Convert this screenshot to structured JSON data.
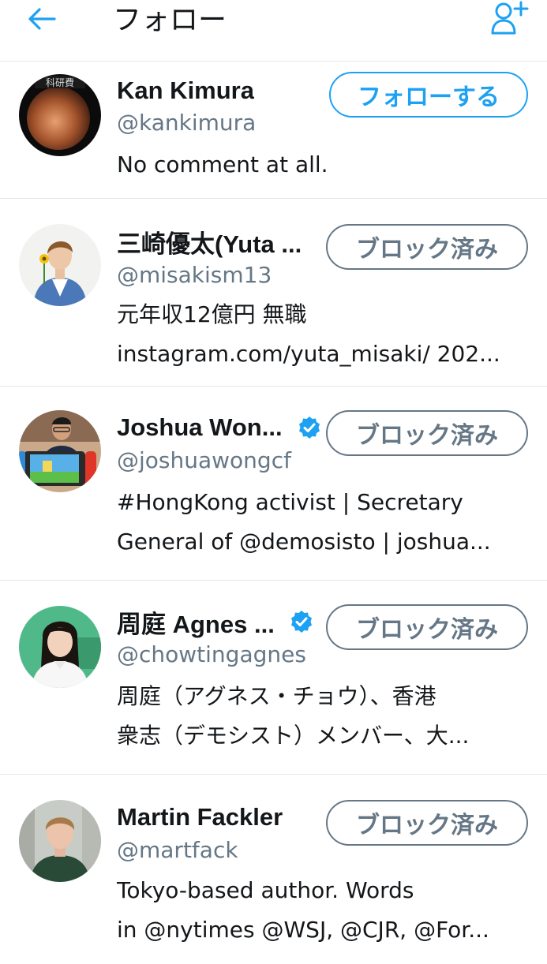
{
  "header": {
    "title": "フォロー",
    "back_icon": "arrow-left-icon",
    "add_icon": "add-user-icon",
    "accent": "#1da1f2"
  },
  "users": [
    {
      "name": "Kan Kimura",
      "handle": "@kankimura",
      "verified": false,
      "button": "フォローする",
      "button_state": "follow",
      "bio": [
        "No comment at all."
      ],
      "avatar_caption": "科研費"
    },
    {
      "name": "三崎優太(Yuta ...",
      "handle": "@misakism13",
      "verified": false,
      "button": "ブロック済み",
      "button_state": "blocked",
      "bio": [
        "元年収12億円 無職",
        "instagram.com/yuta_misaki/ 202..."
      ]
    },
    {
      "name": "Joshua Won...",
      "handle": "@joshuawongcf",
      "verified": true,
      "button": "ブロック済み",
      "button_state": "blocked",
      "bio": [
        "#HongKong activist | Secretary",
        "General of @demosisto | joshua..."
      ]
    },
    {
      "name": "周庭 Agnes ...",
      "handle": "@chowtingagnes",
      "verified": true,
      "button": "ブロック済み",
      "button_state": "blocked",
      "bio": [
        "周庭（アグネス・チョウ）、香港",
        "衆志（デモシスト）メンバー、大..."
      ]
    },
    {
      "name": "Martin Fackler",
      "handle": "@martfack",
      "verified": false,
      "button": "ブロック済み",
      "button_state": "blocked",
      "bio": [
        "Tokyo-based author. Words",
        "in @nytimes @WSJ, @CJR, @For..."
      ]
    }
  ]
}
